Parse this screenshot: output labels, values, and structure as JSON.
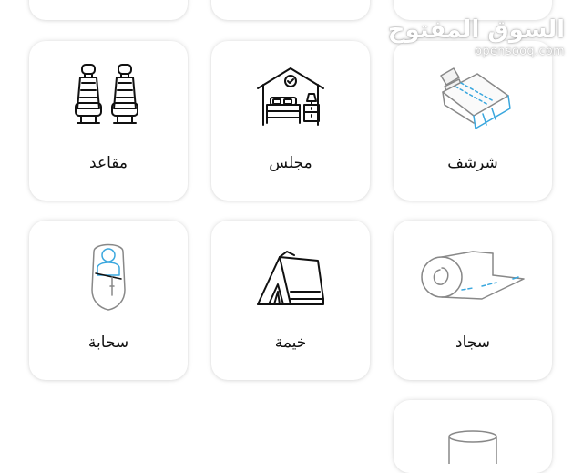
{
  "watermark": {
    "arabic": "السوق المفتوح",
    "latin": "opensooq.com"
  },
  "categories": [
    {
      "label": "شرشف",
      "icon": "bedsheet-icon"
    },
    {
      "label": "مجلس",
      "icon": "majlis-bedroom-icon"
    },
    {
      "label": "مقاعد",
      "icon": "car-seats-icon"
    },
    {
      "label": "سجاد",
      "icon": "rolled-carpet-icon"
    },
    {
      "label": "خيمة",
      "icon": "tent-icon"
    },
    {
      "label": "سحابة",
      "icon": "sleeping-bag-icon"
    }
  ],
  "colors": {
    "accent_blue": "#3aa7de",
    "icon_stroke": "#111111",
    "icon_gray": "#888888"
  }
}
